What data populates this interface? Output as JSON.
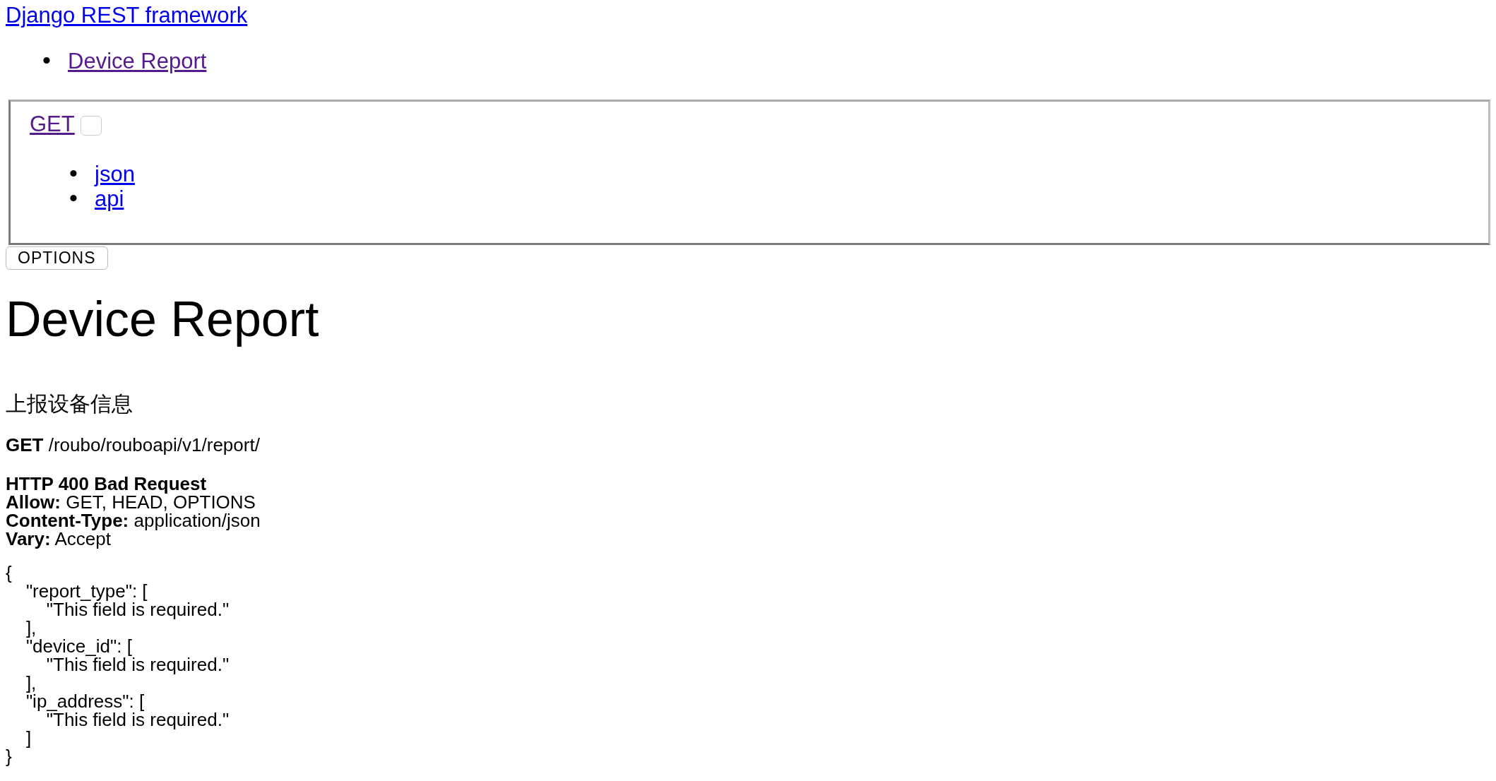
{
  "brand": "Django REST framework",
  "breadcrumbs": [
    {
      "marker": "•",
      "label": "Device Report"
    }
  ],
  "format_menu": {
    "method": "GET",
    "formats": [
      {
        "marker": "•",
        "label": "json"
      },
      {
        "marker": "•",
        "label": "api"
      }
    ]
  },
  "options_button": "OPTIONS",
  "title": "Device Report",
  "description": "上报设备信息",
  "request": {
    "method": "GET",
    "path": "/roubo/rouboapi/v1/report/"
  },
  "response": {
    "status": "HTTP 400 Bad Request",
    "headers": [
      {
        "name": "Allow:",
        "value": "GET, HEAD, OPTIONS"
      },
      {
        "name": "Content-Type:",
        "value": "application/json"
      },
      {
        "name": "Vary:",
        "value": "Accept"
      }
    ],
    "body": "{\n    \"report_type\": [\n        \"This field is required.\"\n    ],\n    \"device_id\": [\n        \"This field is required.\"\n    ],\n    \"ip_address\": [\n        \"This field is required.\"\n    ]\n}"
  }
}
